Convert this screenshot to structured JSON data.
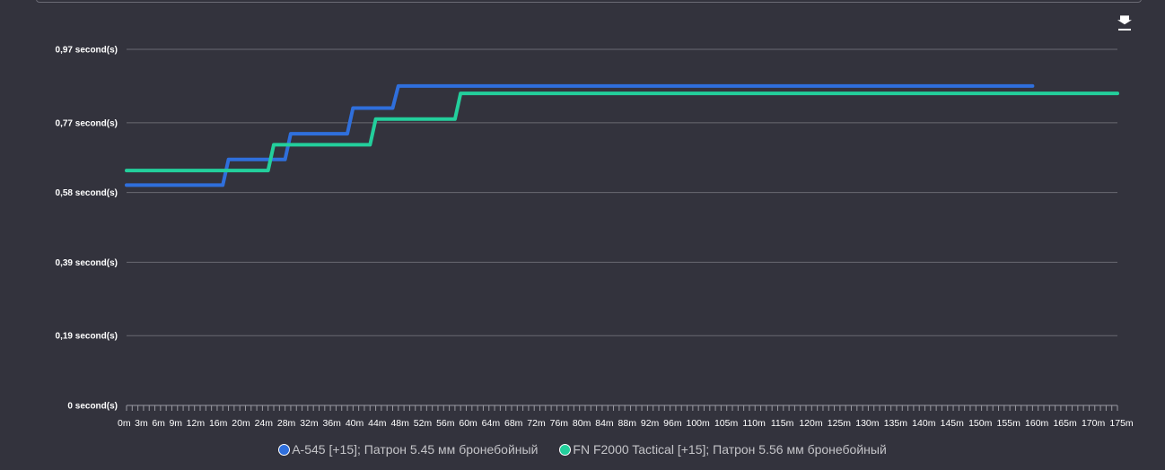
{
  "colors": {
    "background": "#33333d",
    "grid": "#6a6a72",
    "series1": "#2f6fdc",
    "series2": "#23cf9c"
  },
  "toolbar": {
    "download_icon": "download-icon"
  },
  "chart_data": {
    "type": "line",
    "step": true,
    "grid": true,
    "legend_position": "bottom",
    "ylim": [
      0,
      0.97
    ],
    "yticks": [
      0,
      0.19,
      0.39,
      0.58,
      0.77,
      0.97
    ],
    "ytick_labels": [
      "0 second(s)",
      "0,19 second(s)",
      "0,39 second(s)",
      "0,58 second(s)",
      "0,77 second(s)",
      "0,97 second(s)"
    ],
    "x_categories": [
      "0m",
      "3m",
      "6m",
      "9m",
      "12m",
      "16m",
      "20m",
      "24m",
      "28m",
      "32m",
      "36m",
      "40m",
      "44m",
      "48m",
      "52m",
      "56m",
      "60m",
      "64m",
      "68m",
      "72m",
      "76m",
      "80m",
      "84m",
      "88m",
      "92m",
      "96m",
      "100m",
      "105m",
      "110m",
      "115m",
      "120m",
      "125m",
      "130m",
      "135m",
      "140m",
      "145m",
      "150m",
      "155m",
      "160m",
      "165m",
      "170m",
      "175m"
    ],
    "series": [
      {
        "name": "A-545 [+15]; Патрон 5.45 мм бронебойный",
        "color": "#2f6fdc",
        "points": [
          [
            0,
            0.6
          ],
          [
            17,
            0.6
          ],
          [
            18,
            0.67
          ],
          [
            28,
            0.67
          ],
          [
            29,
            0.74
          ],
          [
            39,
            0.74
          ],
          [
            40,
            0.81
          ],
          [
            47,
            0.81
          ],
          [
            48,
            0.87
          ],
          [
            160,
            0.87
          ]
        ]
      },
      {
        "name": "FN F2000 Tactical [+15]; Патрон 5.56 мм бронебойный",
        "color": "#23cf9c",
        "points": [
          [
            0,
            0.64
          ],
          [
            25,
            0.64
          ],
          [
            26,
            0.71
          ],
          [
            43,
            0.71
          ],
          [
            44,
            0.78
          ],
          [
            58,
            0.78
          ],
          [
            59,
            0.85
          ],
          [
            175,
            0.85
          ]
        ]
      }
    ]
  }
}
